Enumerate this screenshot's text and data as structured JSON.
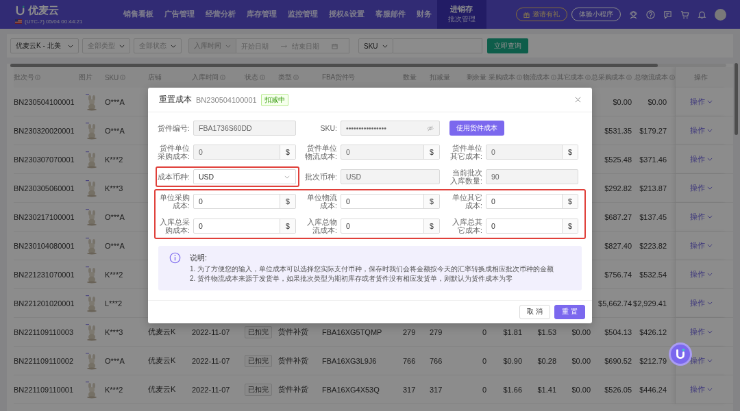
{
  "nav": {
    "brand": "优麦云",
    "clock": "(UTC-7) 05/04 00:44:21",
    "items": [
      {
        "label": "销售看板",
        "selected": false
      },
      {
        "label": "广告管理",
        "selected": false
      },
      {
        "label": "经营分析",
        "selected": false
      },
      {
        "label": "库存管理",
        "selected": false
      },
      {
        "label": "监控管理",
        "selected": false
      },
      {
        "label": "授权&设置",
        "selected": false
      },
      {
        "label": "客服邮件",
        "selected": false
      },
      {
        "label": "财务",
        "selected": false
      },
      {
        "label": "进销存",
        "sub": "批次管理",
        "selected": true
      }
    ],
    "actions": [
      {
        "label": "邀请有礼",
        "kind": "invite"
      },
      {
        "label": "体验小程序",
        "kind": "trial"
      }
    ]
  },
  "filters": {
    "store": "优麦云K - 北美",
    "type_placeholder": "全部类型",
    "status_placeholder": "全部状态",
    "date_field": "入库时间",
    "start_placeholder": "开始日期",
    "end_placeholder": "结束日期",
    "sku_field": "SKU",
    "search_button": "立即查询"
  },
  "table": {
    "columns": [
      {
        "label": "批次号",
        "info": true
      },
      {
        "label": "图片",
        "info": false
      },
      {
        "label": "SKU",
        "info": true
      },
      {
        "label": "店铺",
        "info": false
      },
      {
        "label": "入库时间",
        "info": true
      },
      {
        "label": "状态",
        "info": true
      },
      {
        "label": "类型",
        "info": true
      },
      {
        "label": "FBA货件号",
        "info": false
      },
      {
        "label": "数量",
        "info": false
      },
      {
        "label": "扣减量",
        "info": false
      },
      {
        "label": "剩余量",
        "info": false
      },
      {
        "label": "采购成本",
        "info": true
      },
      {
        "label": "物流成本",
        "info": true
      },
      {
        "label": "其它成本",
        "info": true
      },
      {
        "label": "总采购成本",
        "info": true
      },
      {
        "label": "总物流成本",
        "info": true
      },
      {
        "label": "操作",
        "info": false
      }
    ],
    "rows": [
      {
        "batch_no": "BN230504100001",
        "sku": "O***A",
        "total_purchase_cost": "$0.00",
        "total_logistics_cost": "$0.00",
        "action": "操作"
      },
      {
        "batch_no": "BN230320020001",
        "sku": "O***A",
        "total_purchase_cost": "$531.35",
        "total_logistics_cost": "$179.27",
        "action": "操作"
      },
      {
        "batch_no": "BN230307070001",
        "sku": "K***2",
        "total_purchase_cost": "$525.48",
        "total_logistics_cost": "$371.46",
        "action": "操作"
      },
      {
        "batch_no": "BN230305060001",
        "sku": "K***3",
        "total_purchase_cost": "$292.82",
        "total_logistics_cost": "$213.87",
        "action": "操作"
      },
      {
        "batch_no": "BN230217100001",
        "sku": "O***A",
        "total_purchase_cost": "$687.27",
        "total_logistics_cost": "$137.45",
        "action": "操作"
      },
      {
        "batch_no": "BN230104080001",
        "sku": "O***A",
        "total_purchase_cost": "$827.40",
        "total_logistics_cost": "$223.82",
        "action": "操作"
      },
      {
        "batch_no": "BN221231070001",
        "sku": "K***2",
        "total_purchase_cost": "$756.74",
        "total_logistics_cost": "$532.54",
        "action": "操作"
      },
      {
        "batch_no": "BN221201020001",
        "sku": "L***2",
        "total_purchase_cost": "$5,662.74",
        "total_logistics_cost": "$2,929.41",
        "action": "操作"
      },
      {
        "batch_no": "BN221109110003",
        "sku": "K***3",
        "store": "优麦云K",
        "inbound_date": "2022-11-07",
        "status": "已扣完",
        "type": "货件补货",
        "fba_shipment": "FBA16XG5TQMP",
        "quantity": "279",
        "deducted": "279",
        "remaining": "0",
        "purchase_cost": "$1.81",
        "logistics_cost": "$1.53",
        "other_cost": "$0.00",
        "total_purchase_cost": "$504.13",
        "total_logistics_cost": "$426.12",
        "action": "操作"
      },
      {
        "batch_no": "BN221109110002",
        "sku": "O***A",
        "store": "优麦云K",
        "inbound_date": "2022-11-07",
        "status": "已扣完",
        "type": "货件补货",
        "fba_shipment": "FBA16XG3L9J6",
        "quantity": "766",
        "deducted": "766",
        "remaining": "0",
        "purchase_cost": "$0.90",
        "logistics_cost": "$0.28",
        "other_cost": "$0.00",
        "total_purchase_cost": "$690.52",
        "total_logistics_cost": "$212.79",
        "action": "操作"
      },
      {
        "batch_no": "BN221109110001",
        "sku": "K***2",
        "store": "优麦云K",
        "inbound_date": "2022-11-07",
        "status": "已扣完",
        "type": "货件补货",
        "fba_shipment": "FBA16XG4X53Q",
        "quantity": "317",
        "deducted": "317",
        "remaining": "0",
        "purchase_cost": "$1.66",
        "logistics_cost": "$1.41",
        "other_cost": "$0.00",
        "total_purchase_cost": "$526.05",
        "total_logistics_cost": "$446.24",
        "action": "操作"
      }
    ]
  },
  "dialog": {
    "title": "重置成本",
    "batch_no": "BN230504100001",
    "status_tag": "扣减中",
    "sections": [
      {
        "highlighted": false,
        "rows": [
          [
            {
              "kind": "text",
              "label": "货件编号:",
              "value": "FBA1736S60DD",
              "disabled": true
            },
            {
              "kind": "secret",
              "label": "SKU:",
              "value": "••••••••••••••••",
              "disabled": true
            },
            {
              "kind": "button",
              "label": "使用货件成本"
            }
          ],
          [
            {
              "kind": "money",
              "label": "货件单位采购成本:",
              "value": "0",
              "unit": "$",
              "disabled": true
            },
            {
              "kind": "money",
              "label": "货件单位物流成本:",
              "value": "0",
              "unit": "$",
              "disabled": true
            },
            {
              "kind": "money",
              "label": "货件单位其它成本:",
              "value": "0",
              "unit": "$",
              "disabled": true
            }
          ],
          [
            {
              "kind": "select",
              "label": "成本币种:",
              "value": "USD",
              "disabled": false,
              "highlighted": true
            },
            {
              "kind": "text",
              "label": "批次币种:",
              "value": "USD",
              "disabled": true
            },
            {
              "kind": "text",
              "label": "当前批次入库数量:",
              "value": "90",
              "disabled": true
            }
          ]
        ]
      },
      {
        "highlighted": true,
        "rows": [
          [
            {
              "kind": "money",
              "label": "单位采购成本:",
              "value": "0",
              "unit": "$",
              "disabled": false
            },
            {
              "kind": "money",
              "label": "单位物流成本:",
              "value": "0",
              "unit": "$",
              "disabled": false
            },
            {
              "kind": "money",
              "label": "单位其它成本:",
              "value": "0",
              "unit": "$",
              "disabled": false
            }
          ],
          [
            {
              "kind": "money",
              "label": "入库总采购成本:",
              "value": "0",
              "unit": "$",
              "disabled": false
            },
            {
              "kind": "money",
              "label": "入库总物流成本:",
              "value": "0",
              "unit": "$",
              "disabled": false
            },
            {
              "kind": "money",
              "label": "入库总其它成本:",
              "value": "0",
              "unit": "$",
              "disabled": false
            }
          ]
        ]
      }
    ],
    "notes": {
      "title": "说明:",
      "lines": [
        "1. 为了方便您的输入，单位成本可以选择您实际支付币种，保存时我们会将金额按今天的汇率转换成相应批次币种的金额",
        "2. 货件物流成本来源于发货单，如果批次类型为期初库存或者货件没有相应发货单，则默认为货件成本为零"
      ]
    },
    "buttons": [
      {
        "label": "取 消",
        "kind": "default"
      },
      {
        "label": "重 置",
        "kind": "primary"
      }
    ]
  }
}
